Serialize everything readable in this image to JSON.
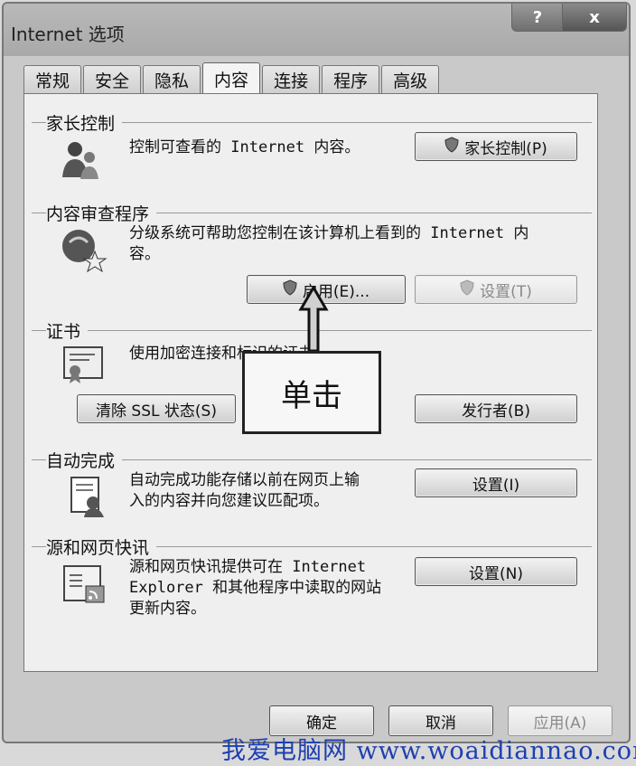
{
  "window": {
    "title": "Internet 选项",
    "help_label": "?",
    "close_label": "x"
  },
  "tabs": [
    {
      "label": "常规"
    },
    {
      "label": "安全"
    },
    {
      "label": "隐私"
    },
    {
      "label": "内容",
      "active": true
    },
    {
      "label": "连接"
    },
    {
      "label": "程序"
    },
    {
      "label": "高级"
    }
  ],
  "parental": {
    "title": "家长控制",
    "description": "控制可查看的 Internet 内容。",
    "button_label": "家长控制(P)"
  },
  "advisor": {
    "title": "内容审查程序",
    "description_line1": "分级系统可帮助您控制在该计算机上看到的 Internet 内",
    "description_line2": "容。",
    "enable_label": "启用(E)...",
    "settings_label": "设置(T)"
  },
  "certificates": {
    "title": "证书",
    "description": "使用加密连接和标识的证书。",
    "clear_ssl_label": "清除 SSL 状态(S)",
    "publishers_label": "发行者(B)"
  },
  "autocomplete": {
    "title": "自动完成",
    "description_line1": "自动完成功能存储以前在网页上输",
    "description_line2": "入的内容并向您建议匹配项。",
    "settings_label": "设置(I)"
  },
  "feeds": {
    "title": "源和网页快讯",
    "description_line1": "源和网页快讯提供可在 Internet",
    "description_line2": "Explorer 和其他程序中读取的网站",
    "description_line3": "更新内容。",
    "settings_label": "设置(N)"
  },
  "footer": {
    "ok_label": "确定",
    "cancel_label": "取消",
    "apply_label": "应用(A)"
  },
  "annotation": {
    "callout_text": "单击"
  },
  "watermark": "我爱电脑网 www.woaidiannao.com"
}
